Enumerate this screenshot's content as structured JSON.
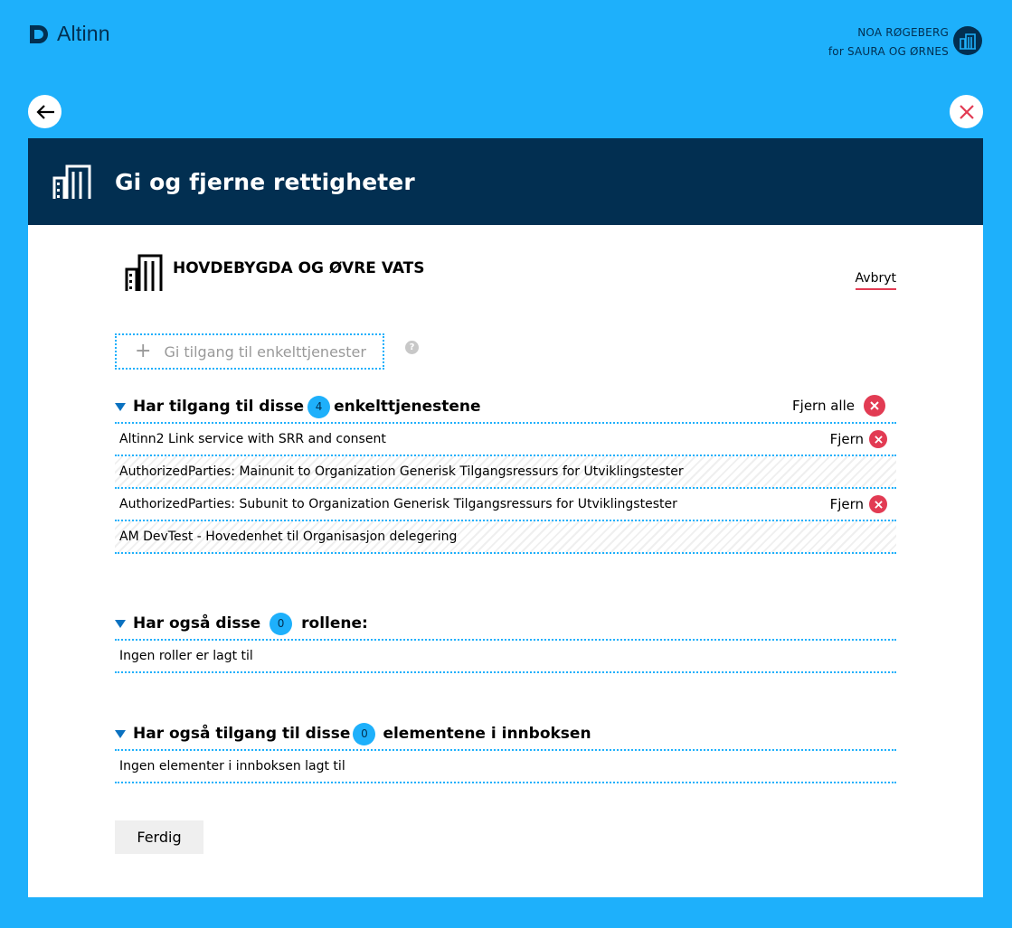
{
  "app": {
    "logo_text": "Altinn"
  },
  "user": {
    "name": "NOA RØGEBERG",
    "on_behalf": "for SAURA OG ØRNES"
  },
  "modal": {
    "title": "Gi og fjerne rettigheter",
    "org_name": "HOVDEBYGDA OG ØVRE VATS",
    "cancel_label": "Avbryt",
    "add_label": "Gi tilgang til enkelttjenester",
    "help_glyph": "?",
    "done_label": "Ferdig"
  },
  "services": {
    "title_before": "Har tilgang til disse",
    "count": "4",
    "title_after": "enkelttjenestene",
    "remove_all_label": "Fjern alle",
    "items": [
      {
        "name": "Altinn2 Link service with SRR and consent",
        "remove_label": "Fjern"
      },
      {
        "name": "AuthorizedParties: Mainunit to Organization Generisk Tilgangsressurs for Utviklingstester",
        "remove_label": ""
      },
      {
        "name": "AuthorizedParties: Subunit to Organization Generisk Tilgangsressurs for Utviklingstester",
        "remove_label": "Fjern"
      },
      {
        "name": "AM DevTest - Hovedenhet til Organisasjon delegering",
        "remove_label": ""
      }
    ]
  },
  "roles": {
    "title_before": "Har også disse",
    "count": "0",
    "title_after": "rollene:",
    "empty_text": "Ingen roller er lagt til"
  },
  "inbox": {
    "title_before": "Har også tilgang til disse",
    "count": "0",
    "title_after": "elementene i innboksen",
    "empty_text": "Ingen elementer i innboksen lagt til"
  },
  "colors": {
    "background": "#1eb0fb",
    "header": "#022f51",
    "danger": "#e23b53"
  }
}
